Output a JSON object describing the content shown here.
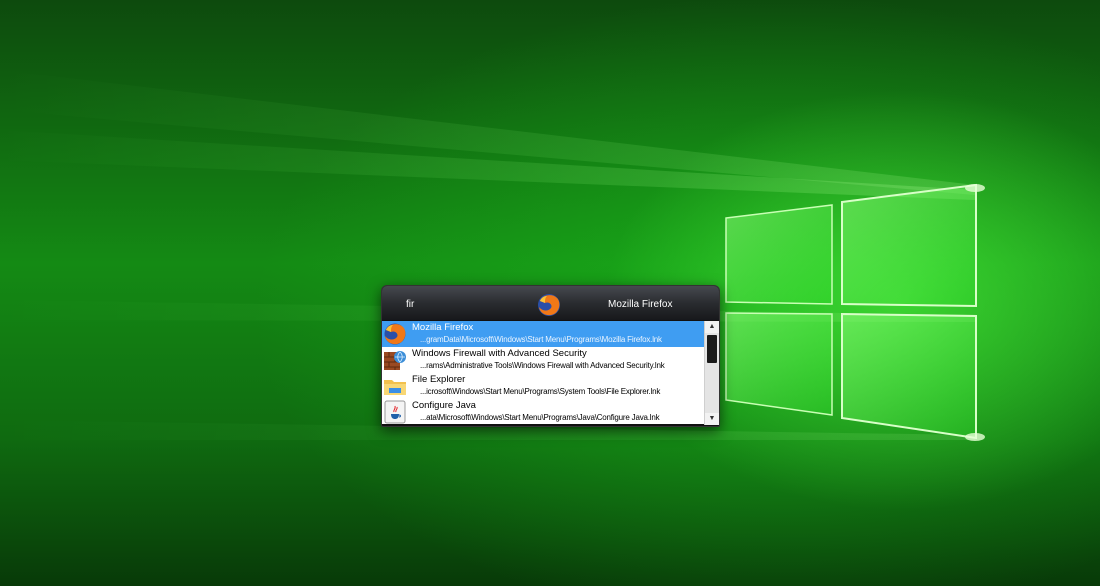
{
  "launcher": {
    "query": "fir",
    "selected_title": "Mozilla Firefox",
    "selected_icon": "firefox-icon",
    "results": [
      {
        "name": "Mozilla Firefox",
        "path": "...gramData\\Microsoft\\Windows\\Start Menu\\Programs\\Mozilla Firefox.lnk",
        "icon": "firefox-icon",
        "selected": true
      },
      {
        "name": "Windows Firewall with Advanced Security",
        "path": "...rams\\Administrative Tools\\Windows Firewall with Advanced Security.lnk",
        "icon": "firewall-icon",
        "selected": false
      },
      {
        "name": "File Explorer",
        "path": "...icrosoft\\Windows\\Start Menu\\Programs\\System Tools\\File Explorer.lnk",
        "icon": "folder-icon",
        "selected": false
      },
      {
        "name": "Configure Java",
        "path": "...ata\\Microsoft\\Windows\\Start Menu\\Programs\\Java\\Configure Java.lnk",
        "icon": "java-icon",
        "selected": false
      }
    ]
  },
  "scrollbar": {
    "up_arrow": "▲",
    "down_arrow": "▼"
  },
  "colors": {
    "selection": "#3f9df2",
    "wallpaper_green": "#148a14"
  }
}
